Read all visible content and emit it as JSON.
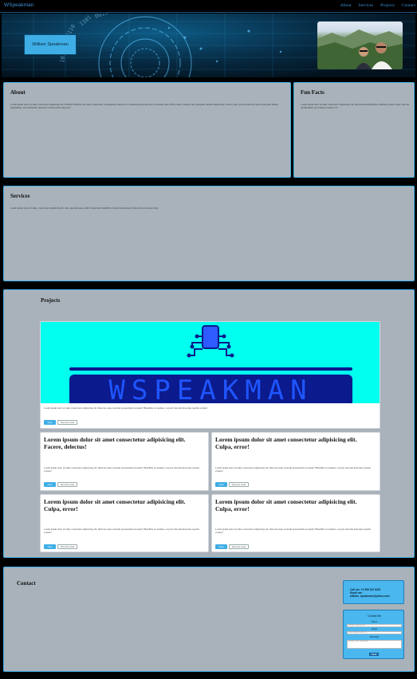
{
  "nav": {
    "brand": "WSpeakman",
    "links": [
      "About",
      "Services",
      "Projects",
      "Contact"
    ]
  },
  "hero": {
    "name": "William Speakman"
  },
  "about": {
    "title": "About",
    "body": "Lorem ipsum dolor sit amet consectetur adipisicing elit. Veritatis blanditiis sed, libero aspernatur consequuntur tenetur in accusamus perspiciatis error reiciendis quae officia nemo voluptas odio quisquam deleniti temporibus, totam a. Quo, quod earum non facilis sequi quia debitis dignissimos, exercitationem, deserunt veritatis natus culpa aut!"
  },
  "fun_facts": {
    "title": "Fun Facts",
    "body": "Lorem ipsum dolor sit amet consectetur adipisicing elit. Recusandae dignissimos similique quaerat quae, nam aut reprehenderit qui voluptate beatae. Ut?"
  },
  "services": {
    "title": "Services",
    "body": "Lorem ipsum dolor sit amet, consectetur adipisicing elit. Quo aperiam neque, nihil voluptatem blanditiis veritatis doloremque facilis dicta non beatae fuga."
  },
  "projects": {
    "title": "Projects",
    "logo_text": "WSPEAKMAN",
    "featured": {
      "body": "Lorem ipsum dolor sit amet consectetur adipisicing elit. Delectus atque nostrum praesentium excepturi? Blanditiis accusamus, corporis laborum molestiae repellat eveniet!",
      "btn_primary": "View",
      "btn_secondary": "View the code"
    },
    "cards": [
      {
        "title": "Lorem ipsum dolor sit amet consectetur adipisicing elit. Facere, delectus!",
        "body": "Lorem ipsum dolor sit amet consectetur adipisicing elit. Delectus atque nostrum praesentium excepturi? Blanditiis accusamus, corporis laborum molestiae repellat eveniet!",
        "btn_primary": "View",
        "btn_secondary": "View the code"
      },
      {
        "title": "Lorem ipsum dolor sit amet consectetur adipisicing elit. Culpa, error!",
        "body": "Lorem ipsum dolor sit amet consectetur adipisicing elit. Delectus atque nostrum praesentium excepturi? Blanditiis accusamus, corporis laborum molestiae repellat eveniet!",
        "btn_primary": "View",
        "btn_secondary": "View the code"
      },
      {
        "title": "Lorem ipsum dolor sit amet consectetur adipisicing elit. Culpa, error!",
        "body": "Lorem ipsum dolor sit amet consectetur adipisicing elit. Delectus atque nostrum praesentium excepturi? Blanditiis accusamus, corporis laborum molestiae repellat eveniet!",
        "btn_primary": "View",
        "btn_secondary": "View the code"
      },
      {
        "title": "Lorem ipsum dolor sit amet consectetur adipisicing elit. Culpa, error!",
        "body": "Lorem ipsum dolor sit amet consectetur adipisicing elit. Delectus atque nostrum praesentium excepturi? Blanditiis accusamus, corporis laborum molestiae repellat eveniet!",
        "btn_primary": "View",
        "btn_secondary": "View the code"
      }
    ]
  },
  "contact": {
    "title": "Contact",
    "call": "Call me: +1 555 347 6321",
    "email_label": "Email me:",
    "email": "william_speakman@yahoo.com",
    "form": {
      "title": "Contact Me",
      "name_label": "Name",
      "name_placeholder": "William Speakman",
      "email_label": "Email",
      "email_placeholder": "example@email.com",
      "message_label": "Message",
      "message_placeholder": "What's your message?",
      "send": "Send"
    }
  },
  "colors": {
    "accent": "#3faee6",
    "card_bg": "#a9b2bb",
    "logo_bg": "#00ffee",
    "logo_navy": "#0b1a8c"
  }
}
